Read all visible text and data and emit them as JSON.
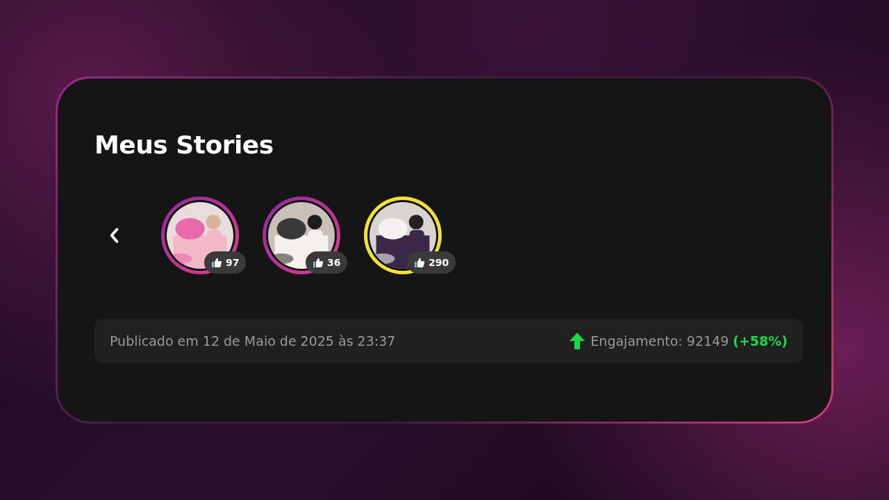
{
  "title": "Meus Stories",
  "stories": [
    {
      "likes": "97",
      "selected": false,
      "kind": "picture"
    },
    {
      "likes": "36",
      "selected": false,
      "kind": "picture"
    },
    {
      "likes": "290",
      "selected": true,
      "kind": "picture"
    }
  ],
  "footer": {
    "published": "Publicado em 12 de Maio de 2025 às 23:37",
    "engagement": "Engajamento: 92149",
    "change": "(+58%)"
  }
}
